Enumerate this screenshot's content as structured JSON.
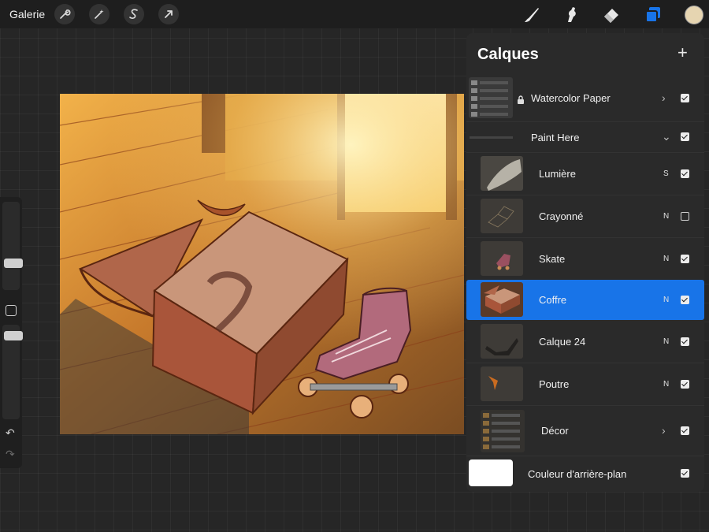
{
  "toolbar": {
    "gallery_label": "Galerie",
    "left_tools": [
      "wrench-icon",
      "magic-wand-icon",
      "selection-s-icon",
      "transform-arrow-icon"
    ],
    "right_tools": [
      "brush-icon",
      "smudge-icon",
      "eraser-icon",
      "layers-icon"
    ],
    "active_tool": "layers-icon",
    "current_color": "#e6d5b1"
  },
  "sidebar": {
    "brush_size": 0.35,
    "opacity": 0.88,
    "undo": "↶",
    "redo": "↷"
  },
  "layers_panel": {
    "title": "Calques",
    "add_label": "+",
    "layers": [
      {
        "name": "Watercolor Paper",
        "locked": true,
        "group": true,
        "expanded": false,
        "visible": true
      },
      {
        "name": "Paint Here",
        "group": true,
        "expanded": true,
        "visible": true
      },
      {
        "name": "Lumière",
        "mode": "S",
        "visible": true
      },
      {
        "name": "Crayonné",
        "mode": "N",
        "visible": false
      },
      {
        "name": "Skate",
        "mode": "N",
        "visible": true
      },
      {
        "name": "Coffre",
        "mode": "N",
        "visible": true,
        "selected": true
      },
      {
        "name": "Calque 24",
        "mode": "N",
        "visible": true
      },
      {
        "name": "Poutre",
        "mode": "N",
        "visible": true
      },
      {
        "name": "Décor",
        "group": true,
        "expanded": false,
        "visible": true
      },
      {
        "name": "Couleur d'arrière-plan",
        "visible": true
      }
    ]
  },
  "colors": {
    "accent": "#1874e8",
    "panel": "#2a2a2a"
  }
}
